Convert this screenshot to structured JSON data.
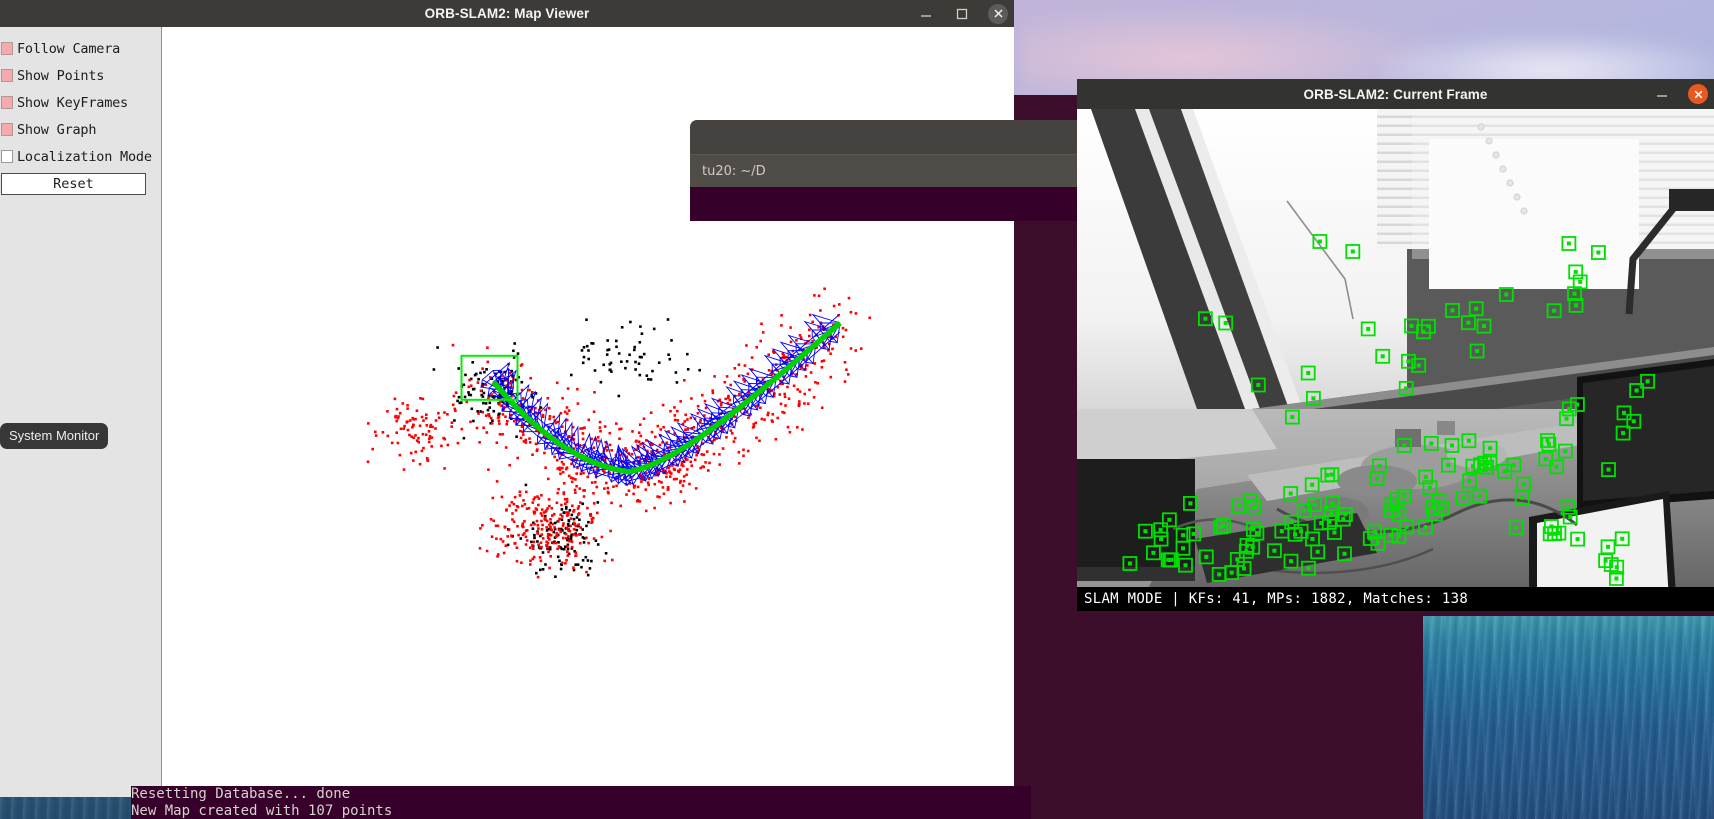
{
  "desktop": {
    "wallpaper_sky": "#b9b6dd",
    "wallpaper_lower": "#3d0d2c",
    "ocean_color": "#26729f"
  },
  "map_viewer": {
    "title": "ORB-SLAM2: Map Viewer",
    "window_buttons": [
      {
        "name": "minimize",
        "glyph": "minimize-icon"
      },
      {
        "name": "maximize",
        "glyph": "maximize-icon"
      },
      {
        "name": "close",
        "glyph": "close-icon"
      }
    ],
    "panel": {
      "checkboxes": [
        {
          "label": "Follow Camera",
          "checked": true
        },
        {
          "label": "Show Points",
          "checked": true
        },
        {
          "label": "Show KeyFrames",
          "checked": true
        },
        {
          "label": "Show Graph",
          "checked": true
        },
        {
          "label": "Localization Mode",
          "checked": false
        }
      ],
      "reset_label": "Reset"
    },
    "canvas": {
      "background": "#ffffff",
      "keyframe_color": "#0000ff",
      "graph_color": "#00d000",
      "current_camera_color": "#00ee00",
      "recent_point_color": "#ff0000",
      "map_point_color": "#000000"
    }
  },
  "tooltip": {
    "system_monitor": "System Monitor"
  },
  "background_terminal": {
    "tab_label": "tu20: ~/D"
  },
  "current_frame": {
    "title": "ORB-SLAM2: Current Frame",
    "window_buttons": [
      {
        "name": "minimize",
        "glyph": "minimize-icon"
      },
      {
        "name": "close",
        "glyph": "close-icon"
      }
    ],
    "status": "SLAM MODE |  KFs: 41, MPs: 1882, Matches: 138",
    "status_fields": {
      "mode": "SLAM MODE",
      "keyframes": 41,
      "map_points": 1882,
      "matches": 138
    },
    "feature_marker_color": "#00e000"
  },
  "console": {
    "lines": [
      "Resetting Database... done",
      "New Map created with 107 points"
    ]
  }
}
